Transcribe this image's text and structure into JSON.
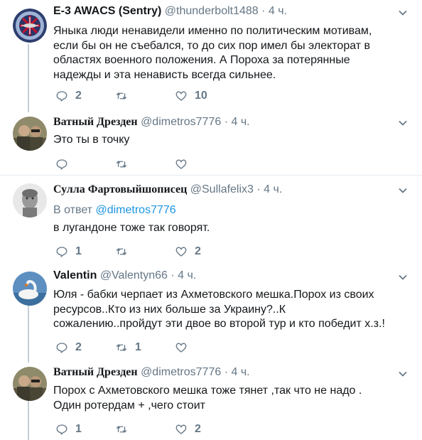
{
  "colors": {
    "accent": "#1b95e0",
    "muted": "#657786",
    "thread": "#c4cfd6"
  },
  "tweets": [
    {
      "name": "E-3 AWACS (Sentry)",
      "handle": "@thunderbolt1488",
      "sep": "·",
      "time": "4 ч.",
      "avatar": "awacs-logo",
      "lines": [
        "Яныка люди ненавидели именно по политическим мотивам,",
        "если бы он не съебался, то до сих пор имел бы электорат в",
        "областях военного положения. А Пороха за потерянные",
        "надежды и эта ненависть всегда сильнее."
      ],
      "replies": "2",
      "retweets": "",
      "likes": "10"
    },
    {
      "name": "Ватный Дрезден",
      "handle": "@dimetros7776",
      "sep": "·",
      "time": "4 ч.",
      "avatar": "photo-two-men",
      "lines": [
        "Это ты в точку"
      ],
      "replies": "",
      "retweets": "",
      "likes": ""
    },
    {
      "name": "Сулла Фартовыйшописец",
      "handle": "@Sullafelix3",
      "sep": "·",
      "time": "4 ч.",
      "avatar": "photo-bust",
      "reply_prefix": "В ответ",
      "reply_mention": "@dimetros7776",
      "lines": [
        "в лугандоне тоже так говорят."
      ],
      "replies": "1",
      "retweets": "",
      "likes": "2"
    },
    {
      "name": "Valentin",
      "handle": "@Valentyn66",
      "sep": "·",
      "time": "4 ч.",
      "avatar": "photo-swan",
      "lines": [
        "Юля - бабки черпает из Ахметовского мешка.Порох из  своих",
        "ресурсов..Кто из них больше за Украину?..К",
        "сожалению..пройдут эти двое во второй тур и кто победит х.з.!"
      ],
      "replies": "2",
      "retweets": "1",
      "likes": ""
    },
    {
      "name": "Ватный Дрезден",
      "handle": "@dimetros7776",
      "sep": "·",
      "time": "4 ч.",
      "avatar": "photo-two-men",
      "lines": [
        "Порох с Ахметовского мешка тоже тянет ,так что не надо .",
        "Один ротердам + ,чего стоит"
      ],
      "replies": "1",
      "retweets": "",
      "likes": "2"
    }
  ]
}
